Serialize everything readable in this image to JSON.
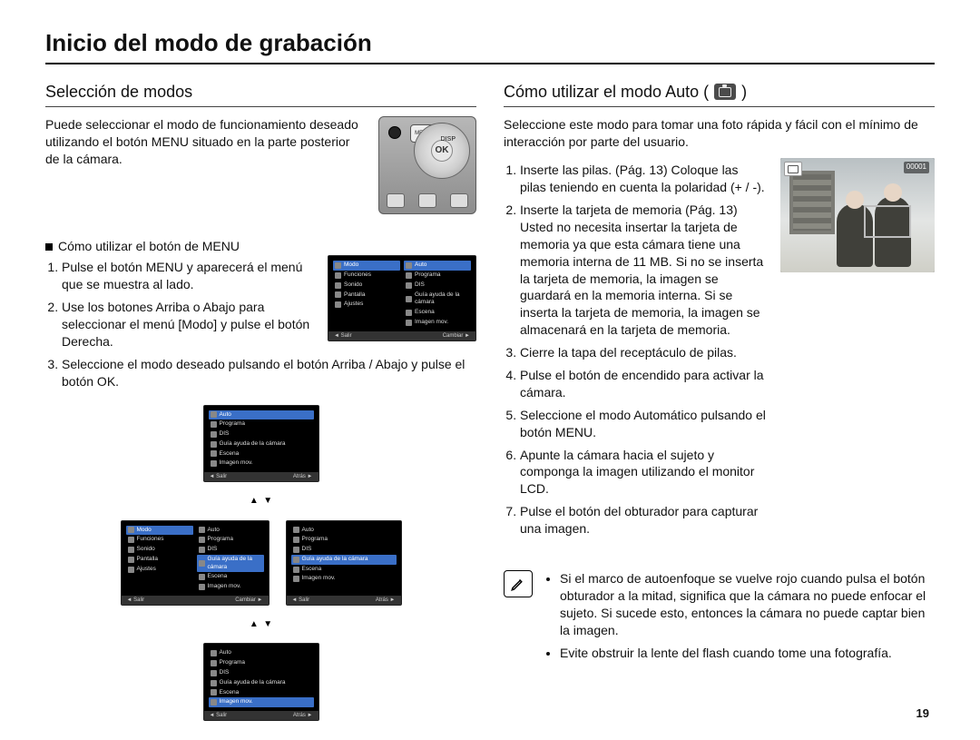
{
  "page_number": "19",
  "title": "Inicio del modo de grabación",
  "left": {
    "heading": "Selección de modos",
    "intro": "Puede seleccionar el modo de funcionamiento deseado utilizando el botón MENU situado en la parte posterior de la cámara.",
    "cam_labels": {
      "menu": "MENU",
      "ok": "OK",
      "disp": "DISP"
    },
    "sub_heading": "Cómo utilizar el botón de MENU",
    "steps": [
      "Pulse el botón MENU y aparecerá el menú que se muestra al lado.",
      "Use los botones Arriba o Abajo para seleccionar el menú [Modo] y pulse el botón Derecha.",
      "Seleccione el modo deseado pulsando el botón Arriba / Abajo y pulse el botón OK."
    ],
    "menu": {
      "left_items": [
        "Modo",
        "Funciones",
        "Sonido",
        "Pantalla",
        "Ajustes"
      ],
      "right_items": [
        "Auto",
        "Programa",
        "DIS",
        "Guía ayuda de la cámara",
        "Escena",
        "Imagen mov."
      ],
      "selected_left": 0,
      "selected_right": 0,
      "footer_left": "Salir",
      "footer_right_change": "Cambiar",
      "footer_right_back": "Atrás"
    }
  },
  "right": {
    "heading_prefix": "Cómo utilizar el modo Auto (",
    "heading_suffix": " )",
    "intro": "Seleccione este modo para tomar una foto rápida y fácil con el mínimo de interacción por parte del usuario.",
    "photo_counter": "00001",
    "steps": [
      "Inserte las pilas. (Pág. 13) Coloque las pilas teniendo en cuenta la polaridad (+ / -).",
      "Inserte la tarjeta de memoria (Pág. 13) Usted no necesita insertar la tarjeta de memoria ya que esta cámara tiene una memoria interna de 11 MB. Si no se inserta la tarjeta de memoria, la imagen se guardará en la memoria interna. Si se inserta la tarjeta de memoria, la imagen se almacenará en la tarjeta de memoria.",
      "Cierre la tapa del receptáculo de pilas.",
      "Pulse el botón de encendido para activar la cámara.",
      "Seleccione el modo Automático pulsando el botón MENU.",
      "Apunte la cámara hacia el sujeto y componga la imagen utilizando el monitor LCD.",
      "Pulse el botón del obturador para capturar una imagen."
    ],
    "notes": [
      "Si el marco de autoenfoque se vuelve rojo cuando pulsa el botón obturador a la mitad, significa que la cámara no puede enfocar el sujeto. Si sucede esto, entonces la cámara no puede captar bien la imagen.",
      "Evite obstruir la lente del flash cuando tome una fotografía."
    ]
  }
}
